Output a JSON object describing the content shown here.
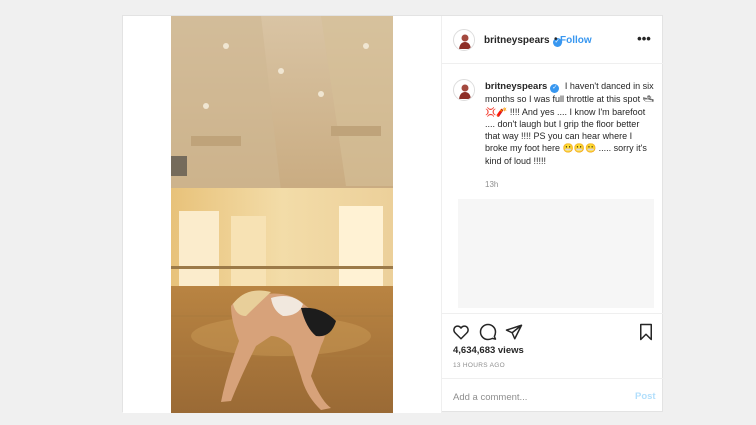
{
  "post": {
    "username": "britneyspears",
    "verified_glyph": "✓",
    "separator": "•",
    "follow_label": "Follow",
    "more_label": "•••",
    "caption": "I haven't danced in six months so I was full throttle at this spot 🛥💢🧨 !!!! And yes .... I know I'm barefoot .... don't laugh but I grip the floor better that way !!!! PS you can hear where I broke my foot here 😬😬😬 ..... sorry it's kind of loud !!!!!",
    "caption_time": "13h",
    "views": "4,634,683 views",
    "time_ago": "13 HOURS AGO"
  },
  "actions": {
    "like_icon": "heart-icon",
    "comment_icon": "comment-bubble-icon",
    "share_icon": "paper-plane-icon",
    "save_icon": "bookmark-icon"
  },
  "comment_box": {
    "placeholder": "Add a comment...",
    "post_label": "Post"
  },
  "colors": {
    "accent": "#3897f0",
    "post_disabled": "#b2dffc",
    "muted": "#8e8e8e"
  }
}
